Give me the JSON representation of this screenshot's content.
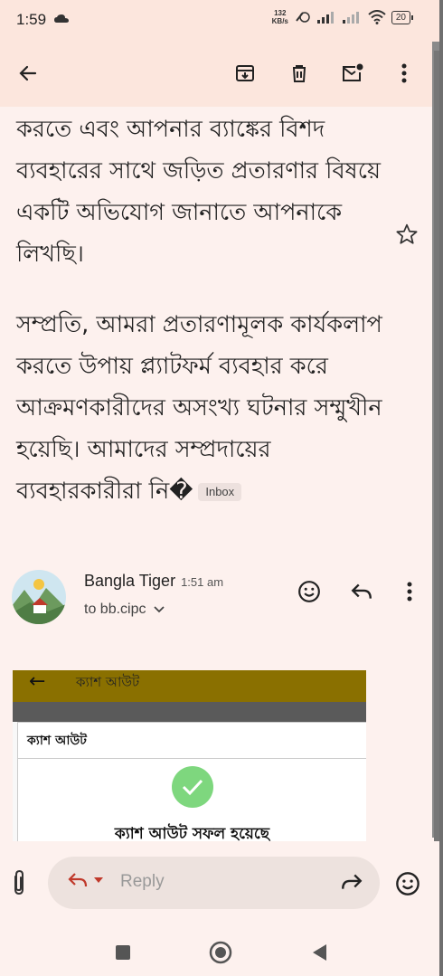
{
  "status_bar": {
    "time": "1:59",
    "speed_value": "132",
    "speed_unit": "KB/s",
    "battery": "20"
  },
  "app_bar": {
    "icons": [
      "back-arrow-icon",
      "archive-icon",
      "delete-icon",
      "mark-unread-icon",
      "more-vert-icon"
    ]
  },
  "email": {
    "paragraphs": [
      "করতে এবং আপনার ব্যাঙ্কের বিশদ ব্যবহারের সাথে জড়িত প্রতারণার বিষয়ে একটি অভিযোগ জানাতে আপনাকে লিখছি।",
      "সম্প্রতি, আমরা প্রতারণামূলক কার্যকলাপ করতে উপায় প্ল্যাটফর্ম ব্যবহার করে আক্রমণকারীদের অসংখ্য ঘটনার সম্মুখীন হয়েছি। আমাদের সম্প্রদায়ের ব্যবহারকারীরা নি�"
    ],
    "label_chip": "Inbox"
  },
  "sender": {
    "name": "Bangla Tiger",
    "time": "1:51 am",
    "to": "to bb.cipc"
  },
  "attachment_screenshot": {
    "header_title": "ক্যাশ আউট",
    "card_title": "ক্যাশ আউট",
    "success_text": "ক্যাশ আউট সফল হয়েছে"
  },
  "reply_bar": {
    "placeholder": "Reply"
  }
}
